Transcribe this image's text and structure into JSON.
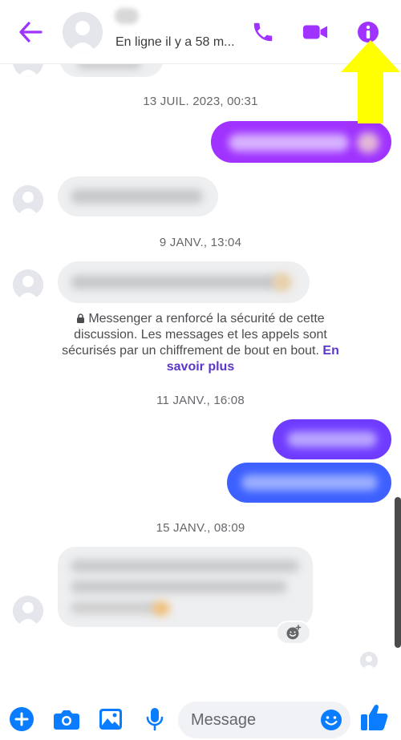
{
  "header": {
    "status": "En ligne il y a 58 m...",
    "accent_color": "#a033ff",
    "icons": [
      "back-arrow-icon",
      "phone-icon",
      "video-camera-icon",
      "info-icon"
    ]
  },
  "conversation": {
    "timestamps": [
      "13 JUIL. 2023, 00:31",
      "9 JANV., 13:04",
      "11 JANV., 16:08",
      "15 JANV., 08:09"
    ],
    "security_notice": "Messenger a renforcé la sécurité de cette discussion. Les messages et les appels sont sécurisés par un chiffrement de bout en bout.",
    "learn_more": "En savoir plus",
    "outgoing_colors": [
      "#a033ff",
      "#6f3cff",
      "#3d60ff"
    ]
  },
  "composer": {
    "placeholder": "Message",
    "icons": [
      "plus-icon",
      "camera-icon",
      "image-icon",
      "microphone-icon",
      "emoji-icon",
      "thumbs-up-icon"
    ],
    "icon_color": "#0a7cff"
  }
}
